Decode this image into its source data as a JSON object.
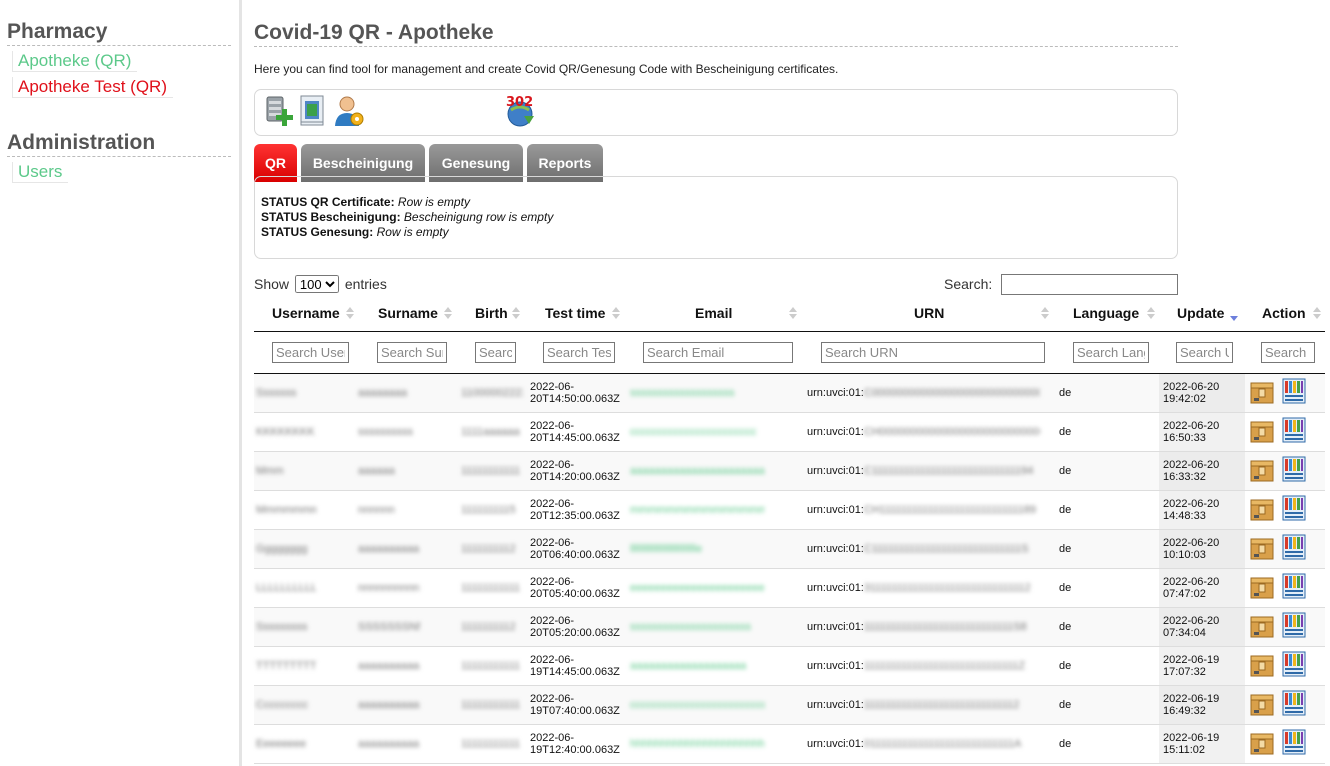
{
  "sidebar": {
    "pharmacy_heading": "Pharmacy",
    "items": [
      {
        "label": "Apotheke (QR)"
      },
      {
        "label": "Apotheke Test (QR)"
      }
    ],
    "admin_heading": "Administration",
    "admin_items": [
      {
        "label": "Users"
      }
    ]
  },
  "main": {
    "title": "Covid-19 QR - Apotheke",
    "intro": "Here you can find tool for management and create Covid QR/Genesung Code with Bescheinigung certificates.",
    "tool_badge": "302"
  },
  "tabs": [
    {
      "label": "QR"
    },
    {
      "label": "Bescheinigung"
    },
    {
      "label": "Genesung"
    },
    {
      "label": "Reports"
    }
  ],
  "status": {
    "qr_label": "STATUS QR Certificate:",
    "qr_value": "Row is empty",
    "besch_label": "STATUS Bescheinigung:",
    "besch_value": "Bescheinigung row is empty",
    "gen_label": "STATUS Genesung:",
    "gen_value": "Row is empty"
  },
  "table_controls": {
    "show_label": "Show",
    "page_size": "100",
    "entries_label": "entries",
    "search_label": "Search:"
  },
  "columns": {
    "username": "Username",
    "surname": "Surname",
    "birth": "Birth",
    "testtime": "Test time",
    "email": "Email",
    "urn": "URN",
    "language": "Language",
    "update": "Update",
    "action": "Action"
  },
  "filters": {
    "username": "Search Username",
    "surname": "Search Surname",
    "birth": "Search Birth",
    "testtime": "Search Test time",
    "email": "Search Email",
    "urn": "Search URN",
    "language": "Search Language",
    "update": "Search Update",
    "action": "Search"
  },
  "rows": [
    {
      "username": "Sssssss",
      "surname": "aaaaaaaa",
      "birth": "11000002222",
      "test_time_1": "2022-06-",
      "test_time_2": "20T14:50:00.063Z",
      "email": "sssssssssssssssssss",
      "urn_prefix": "urn:uvci:01:",
      "urn_rest": "C0000000000000000000000000000000",
      "language": "de",
      "update_1": "2022-06-20",
      "update_2": "19:42:02"
    },
    {
      "username": "KKKKKKKK",
      "surname": "ssssssssss",
      "birth": "1111aaaaaa",
      "test_time_1": "2022-06-",
      "test_time_2": "20T14:45:00.063Z",
      "email": "ccccccccccccccccccccccc",
      "urn_prefix": "urn:uvci:01:",
      "urn_rest": "CH000000000000000000000000000001",
      "language": "de",
      "update_1": "2022-06-20",
      "update_2": "16:50:33"
    },
    {
      "username": "Mmm",
      "surname": "aaaaaa",
      "birth": "11111111111",
      "test_time_1": "2022-06-",
      "test_time_2": "20T14:20:00.063Z",
      "email": "aaaaaaaaaaaaaaaaaaaaaaaa",
      "urn_prefix": "urn:uvci:01:",
      "urn_rest": "C111111111111111111111111111194",
      "language": "de",
      "update_1": "2022-06-20",
      "update_2": "16:33:32"
    },
    {
      "username": "Mmmmmmmmm",
      "surname": "nnnnnn",
      "birth": "1111111115",
      "test_time_1": "2022-06-",
      "test_time_2": "20T12:35:00.063Z",
      "email": "mmmmmmmmmmmmmmmmmmmm",
      "urn_prefix": "urn:uvci:01:",
      "urn_rest": "CH11111111111111111111111111189",
      "language": "de",
      "update_1": "2022-06-20",
      "update_2": "14:48:33"
    },
    {
      "username": "Gggggggg",
      "surname": "aaaaaaaaaa",
      "birth": "1111111112",
      "test_time_1": "2022-06-",
      "test_time_2": "20T06:40:00.063Z",
      "email": "llllllllllllllllllllllllllle",
      "urn_prefix": "urn:uvci:01:",
      "urn_rest": "C1111111111111111111111111111S",
      "language": "de",
      "update_1": "2022-06-20",
      "update_2": "10:10:03"
    },
    {
      "username": "LLLLLLLLLLE",
      "surname": "nnnnnnnnnnn",
      "birth": "11111111111",
      "test_time_1": "2022-06-",
      "test_time_2": "20T05:40:00.063Z",
      "email": "eeeeeeeeeeeeeeeeeeeeeeeeeee",
      "urn_prefix": "urn:uvci:01:",
      "urn_rest": "3111111111111111111111111111112",
      "language": "de",
      "update_1": "2022-06-20",
      "update_2": "07:47:02"
    },
    {
      "username": "Sssssssss",
      "surname": "SSSSSSSNNNN",
      "birth": "1111111112",
      "test_time_1": "2022-06-",
      "test_time_2": "20T05:20:00.063Z",
      "email": "ssssssssssssssssssssss",
      "urn_prefix": "urn:uvci:01:",
      "urn_rest": "1111111111111111111111111111S8",
      "language": "de",
      "update_1": "2022-06-20",
      "update_2": "07:34:04"
    },
    {
      "username": "TTTTTTTTT",
      "surname": "aaaaaaaaaaaa",
      "birth": "11111111111",
      "test_time_1": "2022-06-",
      "test_time_2": "19T14:45:00.063Z",
      "email": "aaaaaaaaaaaaaaaaaaa",
      "urn_prefix": "urn:uvci:01:",
      "urn_rest": "11111111111111111111111111111Z",
      "language": "de",
      "update_1": "2022-06-19",
      "update_2": "17:07:32"
    },
    {
      "username": "Ccccccccc",
      "surname": "aaaaaaaaaarr",
      "birth": "11111111111",
      "test_time_1": "2022-06-",
      "test_time_2": "19T07:40:00.063Z",
      "email": "ccccccccccccccccccccccccc",
      "urn_prefix": "urn:uvci:01:",
      "urn_rest": "11111111111111111111111111112",
      "language": "de",
      "update_1": "2022-06-19",
      "update_2": "16:49:32"
    },
    {
      "username": "Eeeeeeee",
      "surname": "aaaaaaaaaa",
      "birth": "11111111111",
      "test_time_1": "2022-06-",
      "test_time_2": "19T12:40:00.063Z",
      "email": "hhhhhhhhhhhhhhhhhhhhhhhhhhh",
      "urn_prefix": "urn:uvci:01:",
      "urn_rest": "0111111111111111111111111111A",
      "language": "de",
      "update_1": "2022-06-19",
      "update_2": "15:11:02"
    }
  ]
}
